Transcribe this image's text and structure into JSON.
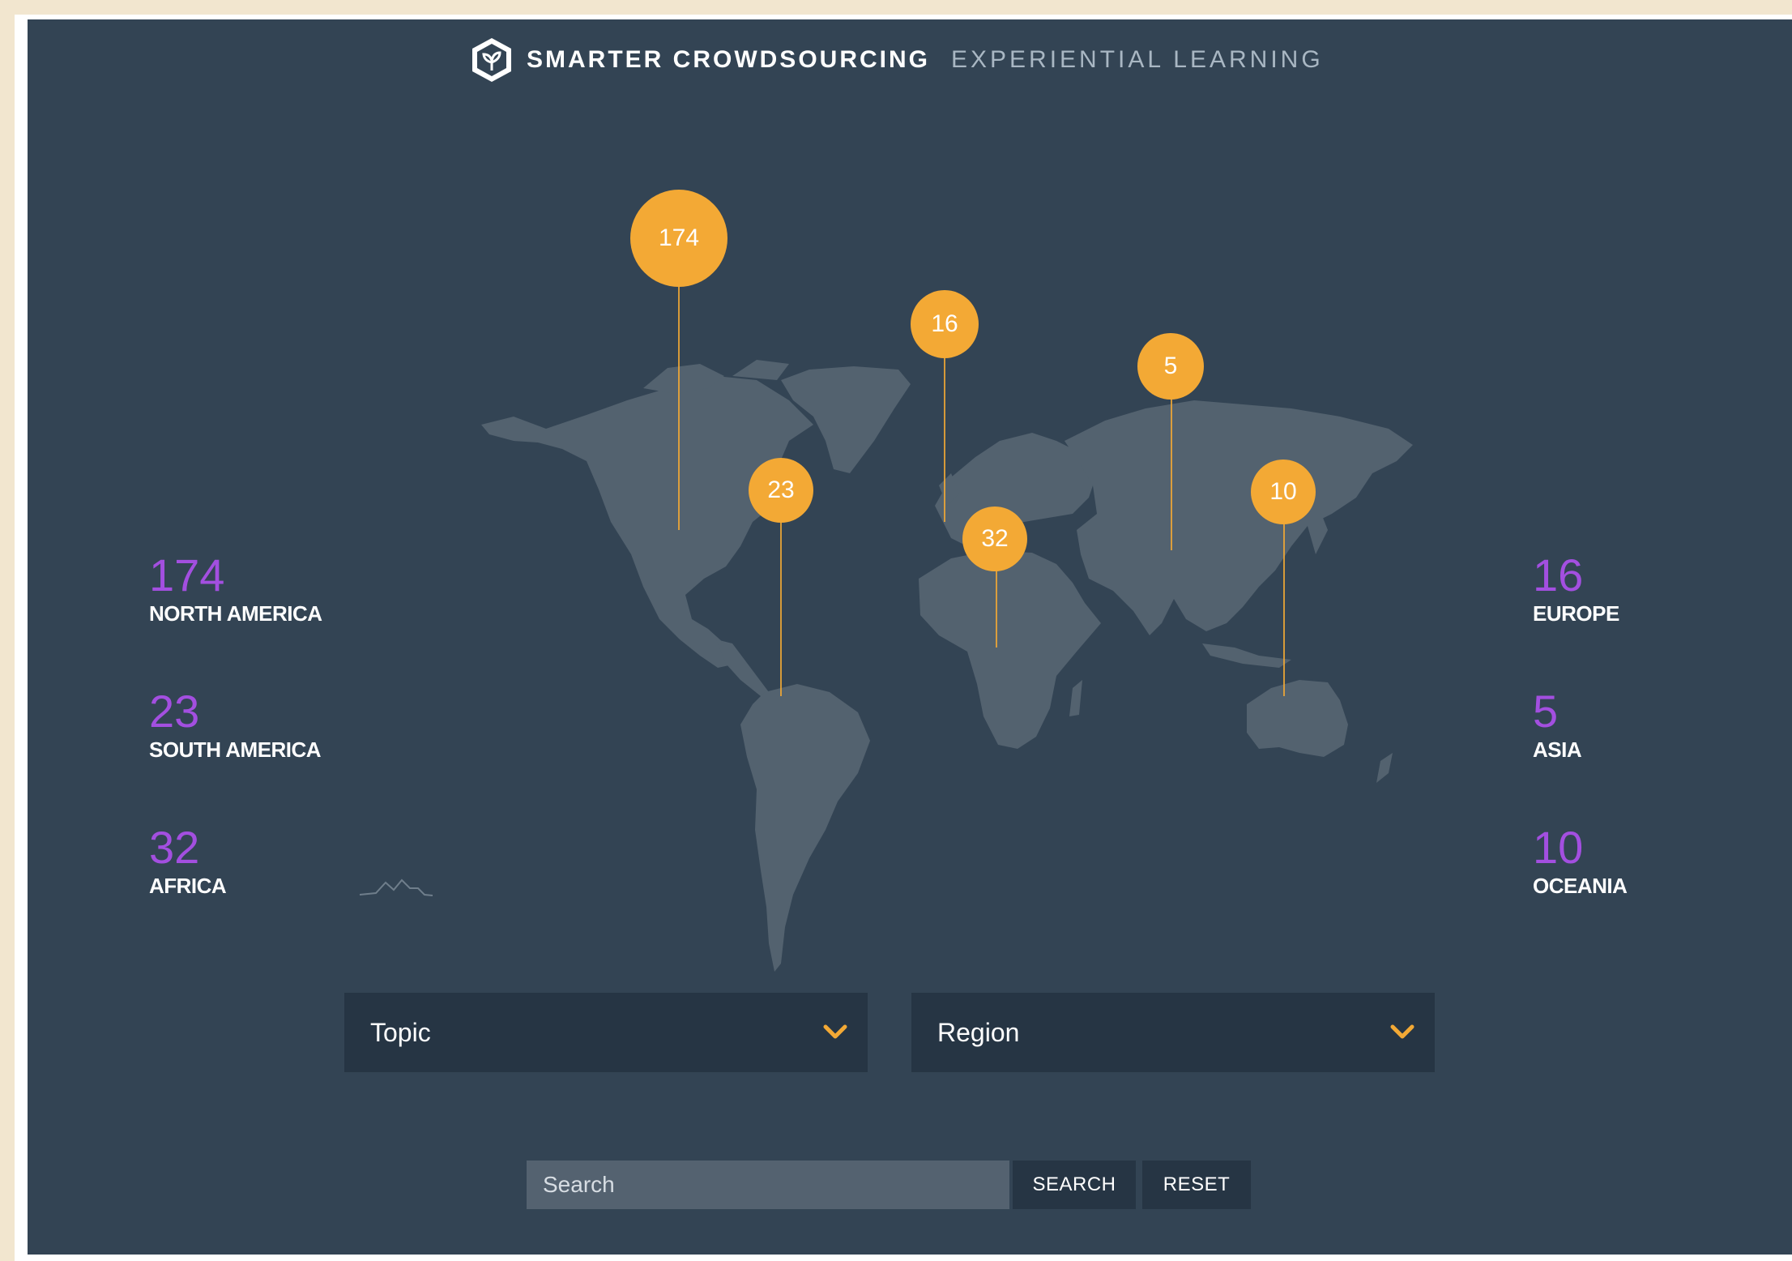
{
  "header": {
    "brand": "SMARTER CROWDSOURCING",
    "subtitle": "EXPERIENTIAL LEARNING",
    "logo_icon": "hexagon-plant-logo"
  },
  "pins": [
    {
      "region": "North America",
      "count": "174"
    },
    {
      "region": "South America",
      "count": "23"
    },
    {
      "region": "Europe",
      "count": "16"
    },
    {
      "region": "Africa",
      "count": "32"
    },
    {
      "region": "Asia",
      "count": "5"
    },
    {
      "region": "Oceania",
      "count": "10"
    }
  ],
  "stats": {
    "left": [
      {
        "value": "174",
        "label": "NORTH AMERICA"
      },
      {
        "value": "23",
        "label": "SOUTH AMERICA"
      },
      {
        "value": "32",
        "label": "AFRICA"
      }
    ],
    "right": [
      {
        "value": "16",
        "label": "EUROPE"
      },
      {
        "value": "5",
        "label": "ASIA"
      },
      {
        "value": "10",
        "label": "OCEANIA"
      }
    ]
  },
  "filters": {
    "topic": {
      "selected": "Topic"
    },
    "region": {
      "selected": "Region"
    }
  },
  "search": {
    "placeholder": "Search",
    "search_label": "SEARCH",
    "reset_label": "RESET"
  },
  "colors": {
    "background": "#334454",
    "land": "#53626f",
    "pin": "#f3a935",
    "stat_number": "#a34fe0",
    "control": "#263544"
  }
}
